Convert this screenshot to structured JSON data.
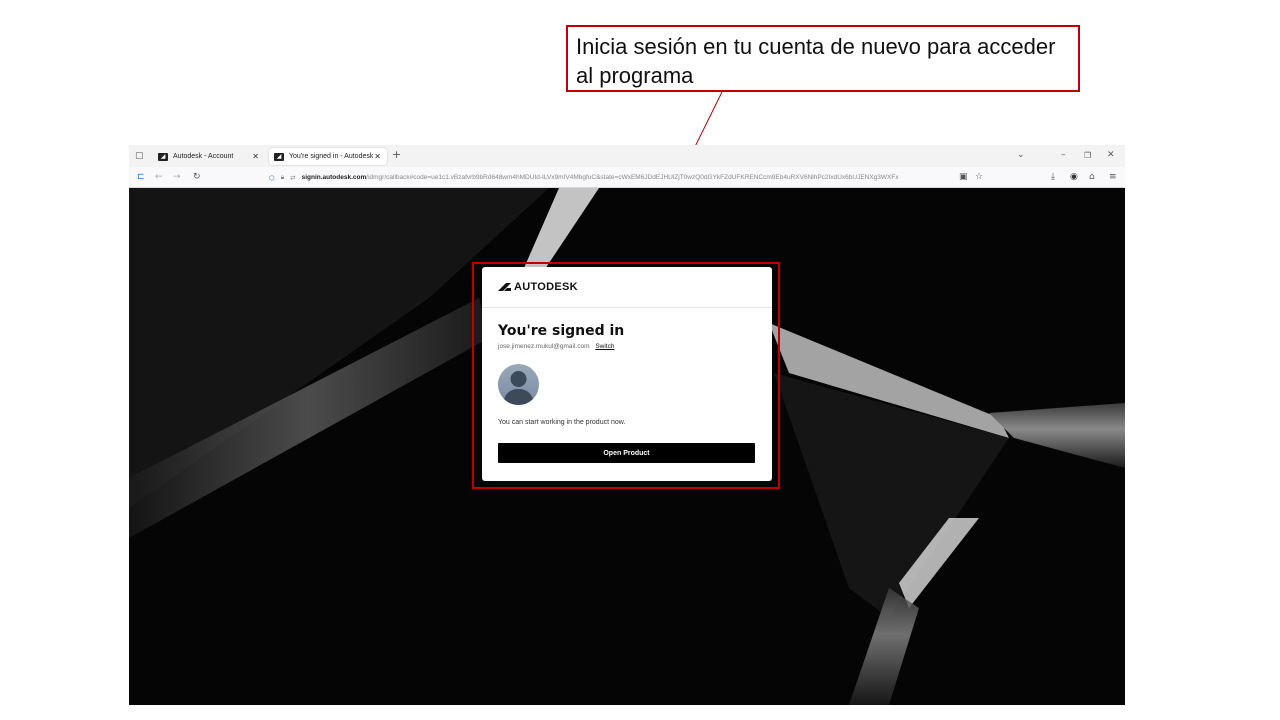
{
  "callout": {
    "text": "Inicia sesión en tu cuenta de nuevo para acceder al programa"
  },
  "browser": {
    "tabs": [
      {
        "label": "Autodesk - Account",
        "active": false
      },
      {
        "label": "You're signed in - Autodesk",
        "active": true
      }
    ],
    "url_domain": "signin.autodesk.com",
    "url_path": "/idmgr/callback#code=ue1c1.vBzafvrb9bRd648wm4hMDUId-ILVx9mIV4MbgfuC&state=cWxEM6JDdEJHUlZjT0wzQ0dGYkFZdUFKRENCcm9Eb4uRXV6NlhPc2IxdUx6bUJENXg3WXFx"
  },
  "card": {
    "brand": "AUTODESK",
    "title": "You're signed in",
    "email": "jose.jimenez.mukul@gmail.com",
    "switch_label": "Switch",
    "message": "You can start working in the product now.",
    "button_label": "Open Product"
  },
  "colors": {
    "highlight": "#c00000",
    "button": "#000000"
  }
}
